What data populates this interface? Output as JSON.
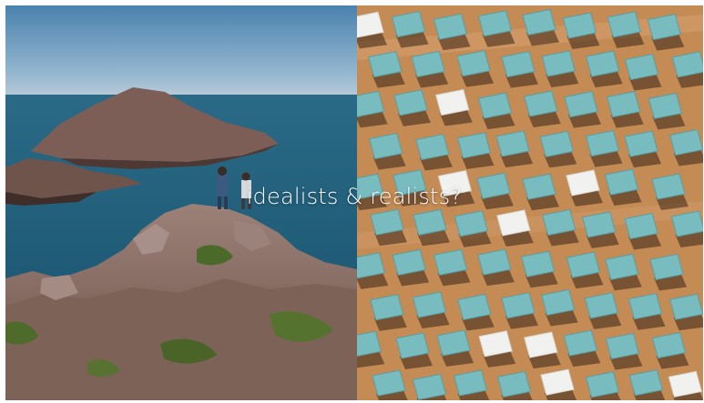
{
  "caption": "idealists & realists?",
  "colors": {
    "sky_top": "#4f86b0",
    "sky_bottom": "#a9c3d6",
    "sea": "#1f5f78",
    "rock": "#8a6d63",
    "rock_dark": "#5a4440",
    "grass": "#4f6a2e",
    "desert": "#c8925c",
    "panel": "#7bbfc2",
    "panel_white": "#f3f4f1",
    "shadow": "#3a2a1e"
  }
}
